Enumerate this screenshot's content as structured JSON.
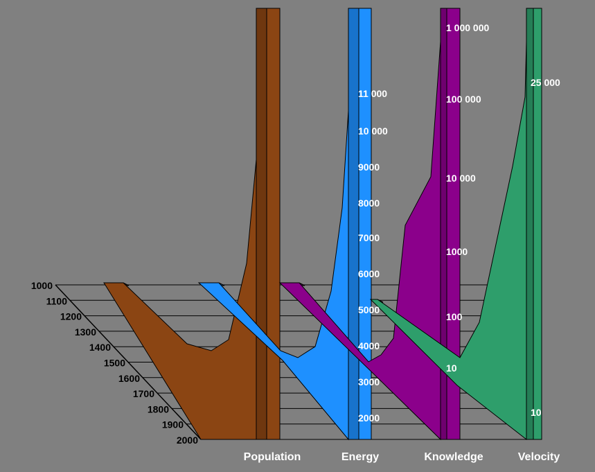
{
  "chart_data": {
    "type": "area",
    "x_axis": {
      "ticks": [
        "1000",
        "1100",
        "1200",
        "1300",
        "1400",
        "1500",
        "1600",
        "1700",
        "1800",
        "1900",
        "2000"
      ]
    },
    "series": [
      {
        "name": "Population",
        "color": "#8B4513",
        "ticks": [],
        "values": []
      },
      {
        "name": "Energy",
        "color": "#1E90FF",
        "ticks": [
          "2000",
          "3000",
          "4000",
          "5000",
          "6000",
          "7000",
          "8000",
          "9000",
          "10 000",
          "11 000"
        ],
        "values": []
      },
      {
        "name": "Knowledge",
        "color": "#8B008B",
        "ticks": [
          "10",
          "100",
          "1000",
          "10 000",
          "100 000",
          "1 000 000"
        ],
        "values": []
      },
      {
        "name": "Velocity",
        "color": "#2E9E6B",
        "ticks": [
          "10",
          "25 000"
        ],
        "values": []
      }
    ]
  }
}
